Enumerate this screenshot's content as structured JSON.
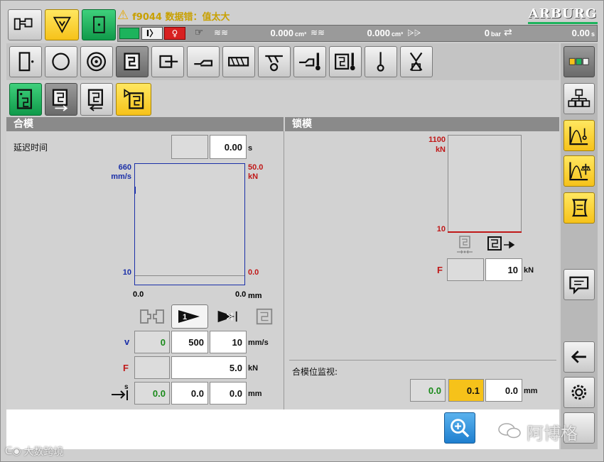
{
  "header": {
    "alarm_text": "f9044 数据错：值太大",
    "brand": "ARBURG",
    "status": [
      {
        "value": "0.000",
        "unit": "cm³"
      },
      {
        "value": "0.000",
        "unit": "cm³"
      },
      {
        "value": "0",
        "unit": "bar"
      },
      {
        "value": "0.00",
        "unit": "s"
      }
    ]
  },
  "sections": {
    "left_title": "合模",
    "right_title": "锁模"
  },
  "left": {
    "delay_label": "延迟时间",
    "delay_value": "0.00",
    "delay_unit": "s",
    "chart": {
      "y_left_max": "660",
      "y_left_unit": "mm/s",
      "y_left_min": "10",
      "y_right_max": "50.0",
      "y_right_unit": "kN",
      "y_right_min": "0.0",
      "x_min": "0.0",
      "x_max": "0.0",
      "x_unit": "mm"
    },
    "rows": {
      "v_label": "v",
      "v_values": [
        "0",
        "500",
        "10"
      ],
      "v_unit": "mm/s",
      "f_label": "F",
      "f_value": "5.0",
      "f_unit": "kN",
      "s_values": [
        "0.0",
        "0.0",
        "0.0"
      ],
      "s_unit": "mm"
    }
  },
  "right": {
    "chart": {
      "y_max": "1100",
      "y_unit": "kN",
      "y_min": "10"
    },
    "f_label": "F",
    "f_value": "10",
    "f_unit": "kN",
    "monitor_label": "合模位监视:",
    "monitor_values": [
      "0.0",
      "0.1",
      "0.0"
    ],
    "monitor_unit": "mm"
  },
  "watermark": {
    "brand": "阿博格",
    "footer": "大数跨境"
  },
  "colors": {
    "green": "#1db35c",
    "yellow": "#f6c21a",
    "blue_axis": "#1a2fa8",
    "red_axis": "#c01818"
  }
}
